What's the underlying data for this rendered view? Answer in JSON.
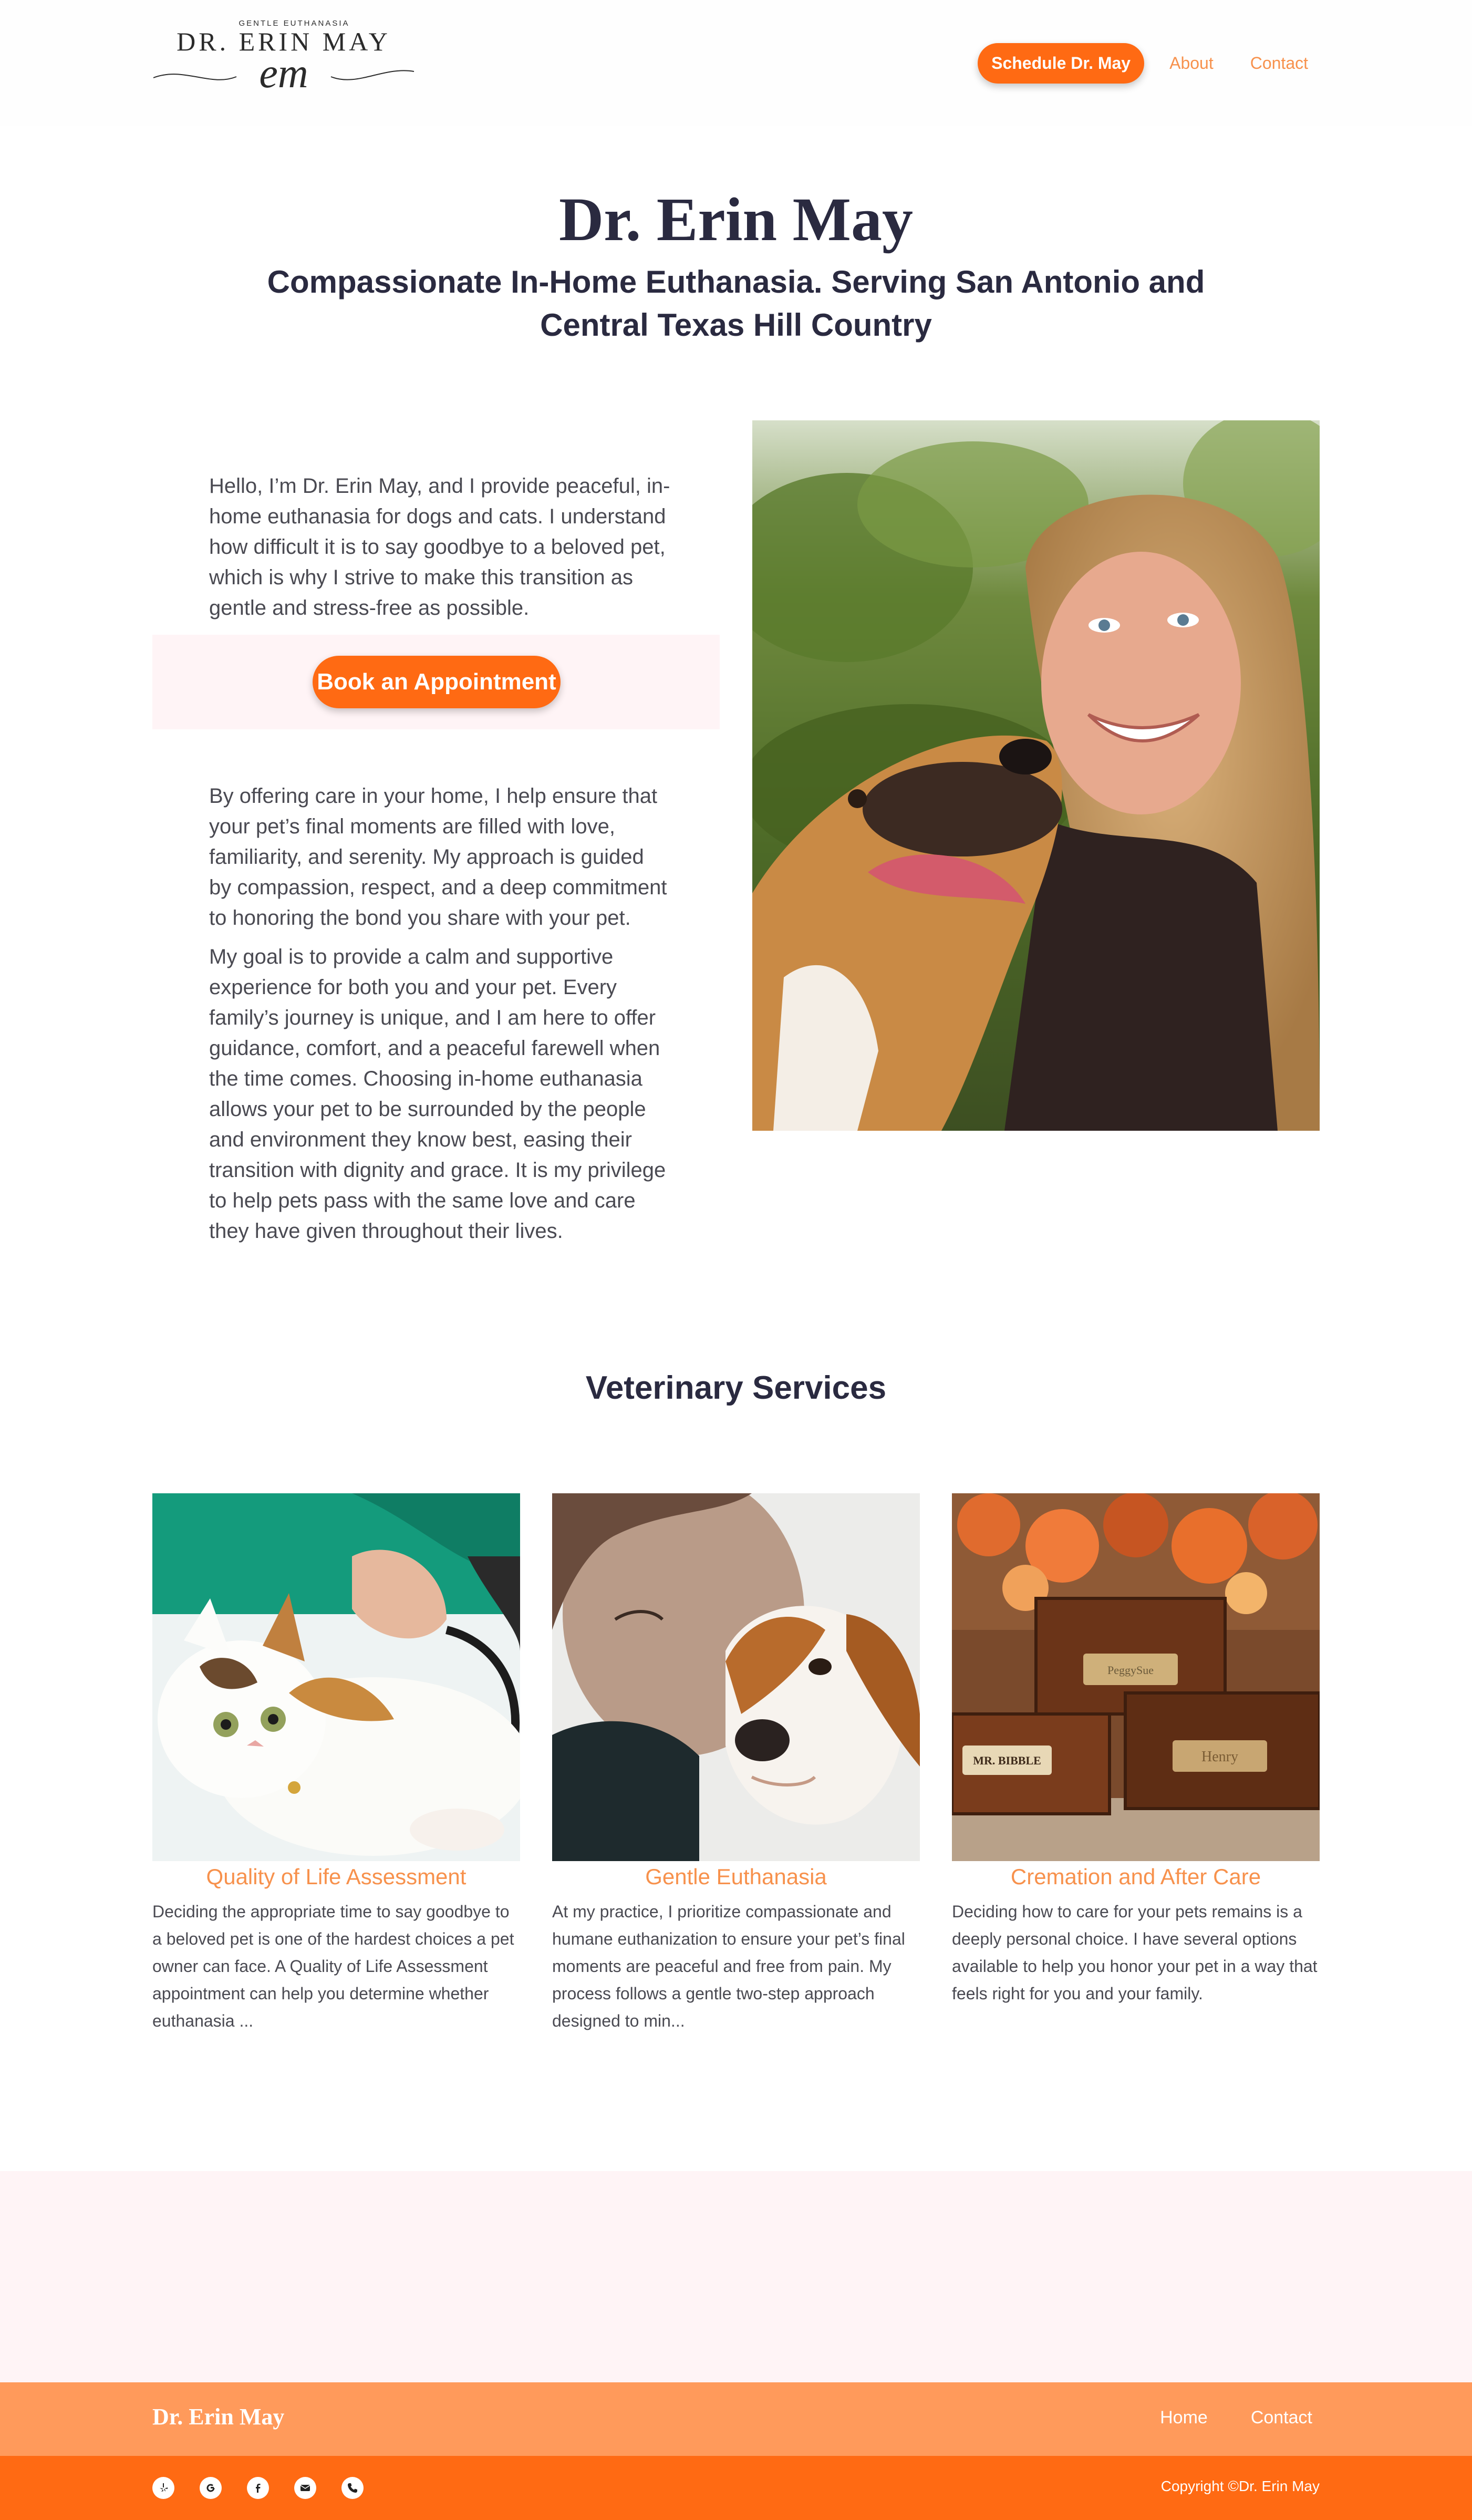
{
  "header": {
    "logo": {
      "tagline": "GENTLE EUTHANASIA",
      "name": "DR. ERIN MAY",
      "monogram": "em"
    },
    "nav": {
      "cta_label": "Schedule Dr. May",
      "items": [
        {
          "label": "About"
        },
        {
          "label": "Contact"
        }
      ]
    }
  },
  "hero": {
    "title": "Dr. Erin May",
    "subtitle": "Compassionate In-Home Euthanasia. Serving San Antonio and Central Texas Hill Country"
  },
  "intro": {
    "paragraph_1": "Hello, I’m Dr. Erin May, and I provide peaceful, in-home euthanasia for dogs and cats. I understand how difficult it is to say goodbye to a beloved pet, which is why I strive to make this transition as gentle and stress-free as possible.",
    "book_button": "Book an Appointment",
    "paragraph_2": "By offering care in your home, I help ensure that your pet’s final moments are filled with love, familiarity, and serenity. My approach is guided by compassion, respect, and a deep commitment to honoring the bond you share with your pet.",
    "paragraph_3": "My goal is to provide a calm and supportive experience for both you and your pet. Every family’s journey is unique, and I am here to offer guidance, comfort, and a peaceful farewell when the time comes. Choosing in-home euthanasia allows your pet to be surrounded by the people and environment they know best, easing their transition with dignity and grace. It is my privilege to help pets pass with the same love and care they have given throughout their lives."
  },
  "services": {
    "title": "Veterinary Services",
    "cards": [
      {
        "title": "Quality of Life Assessment",
        "text": "Deciding the appropriate time to say goodbye to a beloved pet is one of the hardest choices a pet owner can face. A Quality of Life Assessment appointment can help you determine whether euthanasia ..."
      },
      {
        "title": "Gentle Euthanasia",
        "text": "At my practice, I prioritize compassionate and humane euthanization to ensure your pet’s final moments are peaceful and free from pain. My process follows a gentle two-step approach designed to min..."
      },
      {
        "title": "Cremation and After Care",
        "text": "Deciding how to care for your pets remains is a deeply personal choice. I have several options available to help you honor your pet in a way that feels right for you and your family.",
        "urn_labels": [
          "PeggySue",
          "MR. BIBBLE",
          "Henry"
        ]
      }
    ]
  },
  "footer": {
    "brand": "Dr. Erin May",
    "nav": [
      {
        "label": "Home"
      },
      {
        "label": "Contact"
      }
    ],
    "socials": [
      "yelp-icon",
      "google-icon",
      "facebook-icon",
      "email-icon",
      "phone-icon"
    ],
    "copyright": "Copyright ©Dr. Erin May"
  },
  "colors": {
    "accent": "#ff6a13",
    "accent_light": "#ff9a5b",
    "link": "#f7914c",
    "heading": "#2a2a40",
    "band": "#fff4f6"
  }
}
